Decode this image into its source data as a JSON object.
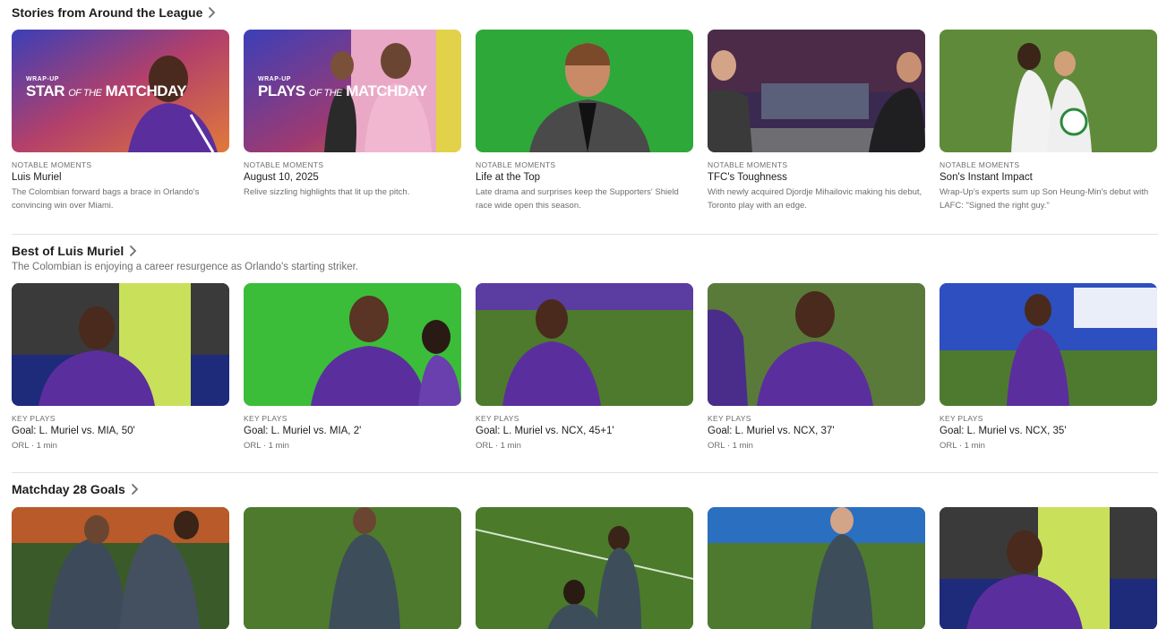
{
  "sections": [
    {
      "title": "Stories from Around the League",
      "cards": [
        {
          "kicker": "NOTABLE MOMENTS",
          "title": "Luis Muriel",
          "desc": "The Colombian forward bags a brace in Orlando's convincing win over Miami.",
          "overlay_small": "WRAP-UP",
          "overlay_big": "STAR",
          "overlay_mid": "OF THE",
          "overlay_end": "MATCHDAY"
        },
        {
          "kicker": "NOTABLE MOMENTS",
          "title": "August 10, 2025",
          "desc": "Relive sizzling highlights that lit up the pitch.",
          "overlay_small": "WRAP-UP",
          "overlay_big": "PLAYS",
          "overlay_mid": "OF THE",
          "overlay_end": "MATCHDAY"
        },
        {
          "kicker": "NOTABLE MOMENTS",
          "title": "Life at the Top",
          "desc": "Late drama and surprises keep the Supporters' Shield race wide open this season."
        },
        {
          "kicker": "NOTABLE MOMENTS",
          "title": "TFC's Toughness",
          "desc": "With newly acquired Djordje Mihailovic making his debut, Toronto play with an edge."
        },
        {
          "kicker": "NOTABLE MOMENTS",
          "title": "Son's Instant Impact",
          "desc": "Wrap-Up's experts sum up Son Heung-Min's debut with LAFC: \"Signed the right guy.\""
        }
      ]
    },
    {
      "title": "Best of Luis Muriel",
      "subtitle": "The Colombian is enjoying a career resurgence as Orlando's starting striker.",
      "cards": [
        {
          "kicker": "KEY PLAYS",
          "title": "Goal: L. Muriel vs. MIA, 50'",
          "desc": "ORL · 1 min"
        },
        {
          "kicker": "KEY PLAYS",
          "title": "Goal: L. Muriel vs. MIA, 2'",
          "desc": "ORL · 1 min"
        },
        {
          "kicker": "KEY PLAYS",
          "title": "Goal: L. Muriel vs. NCX, 45+1'",
          "desc": "ORL · 1 min"
        },
        {
          "kicker": "KEY PLAYS",
          "title": "Goal: L. Muriel vs. NCX, 37'",
          "desc": "ORL · 1 min"
        },
        {
          "kicker": "KEY PLAYS",
          "title": "Goal: L. Muriel vs. NCX, 35'",
          "desc": "ORL · 1 min"
        }
      ]
    },
    {
      "title": "Matchday 28 Goals",
      "cards": [
        {},
        {},
        {},
        {},
        {}
      ]
    }
  ],
  "icons": {
    "chevron": "chevron-right-icon"
  },
  "colors": {
    "orlando_purple": "#5b2e9e",
    "pitch_green": "#4d7a2c",
    "chroma_green": "#2fa83a"
  }
}
